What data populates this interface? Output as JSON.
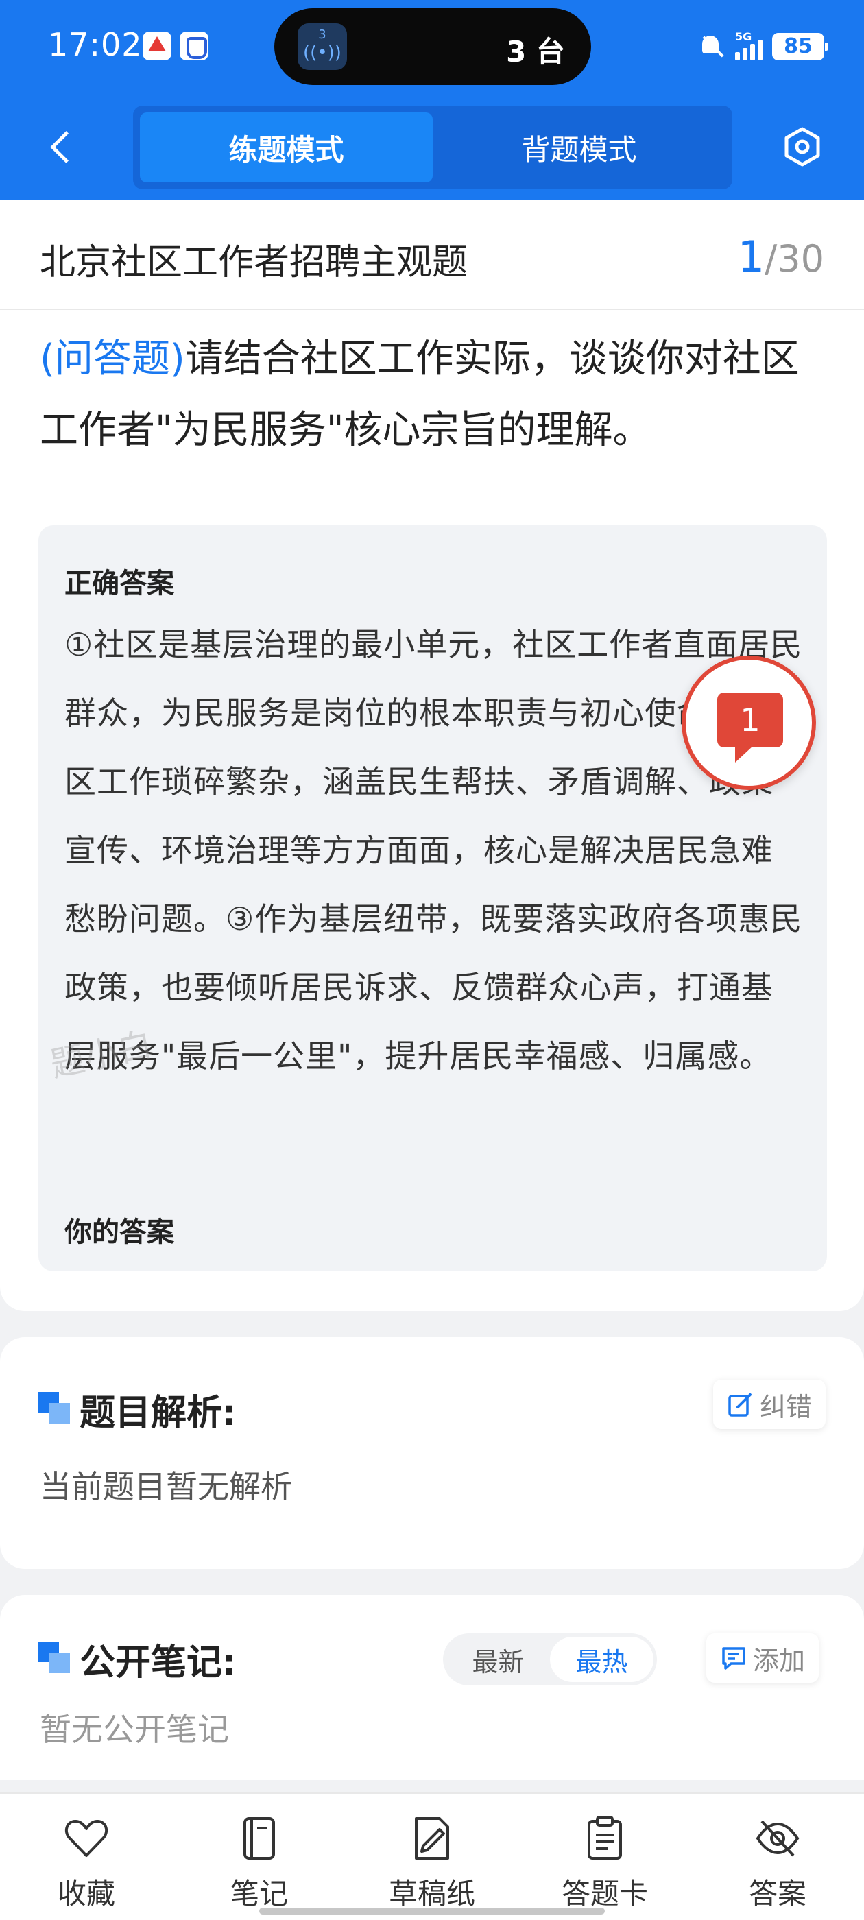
{
  "status_bar": {
    "time": "17:02",
    "island_count": "3",
    "island_text": "3 台",
    "network": "5G",
    "battery": "85",
    "notification_icons": [
      "app-a-icon",
      "app-shield-icon"
    ],
    "status_icons": [
      "bell-muted-icon",
      "signal-icon",
      "battery-icon"
    ]
  },
  "nav": {
    "back_icon": "chevron-left-icon",
    "tabs": [
      {
        "label": "练题模式",
        "active": true
      },
      {
        "label": "背题模式",
        "active": false
      }
    ],
    "settings_icon": "hexagon-settings-icon"
  },
  "question": {
    "section_title": "北京社区工作者招聘主观题",
    "current": "1",
    "separator": "/",
    "total": "30",
    "type": "(问答题)",
    "text": "请结合社区工作实际，谈谈你对社区工作者\"为民服务\"核心宗旨的理解。",
    "comment_badge": "1"
  },
  "answer": {
    "correct_label": "正确答案",
    "correct_text": "①社区是基层治理的最小单元，社区工作者直面居民群众，为民服务是岗位的根本职责与初心使命。②社区工作琐碎繁杂，涵盖民生帮扶、矛盾调解、政策宣传、环境治理等方方面面，核心是解决居民急难愁盼问题。③作为基层纽带，既要落实政府各项惠民政策，也要倾听居民诉求、反馈群众心声，打通基层服务\"最后一公里\"，提升居民幸福感、归属感。",
    "your_label": "你的答案",
    "watermark": "题小白"
  },
  "analysis": {
    "title": "题目解析:",
    "report_button": "纠错",
    "empty": "当前题目暂无解析"
  },
  "notes": {
    "title": "公开笔记:",
    "sort_options": [
      {
        "label": "最新",
        "active": false
      },
      {
        "label": "最热",
        "active": true
      }
    ],
    "add_button": "添加",
    "empty": "暂无公开笔记"
  },
  "bottom_bar": [
    {
      "label": "收藏",
      "icon": "heart-icon"
    },
    {
      "label": "笔记",
      "icon": "notebook-icon"
    },
    {
      "label": "草稿纸",
      "icon": "draft-paper-icon"
    },
    {
      "label": "答题卡",
      "icon": "answer-card-icon"
    },
    {
      "label": "答案",
      "icon": "eye-off-icon"
    }
  ],
  "colors": {
    "primary": "#1a78f0",
    "badge_red": "#e04738",
    "background": "#f1f2f4"
  }
}
